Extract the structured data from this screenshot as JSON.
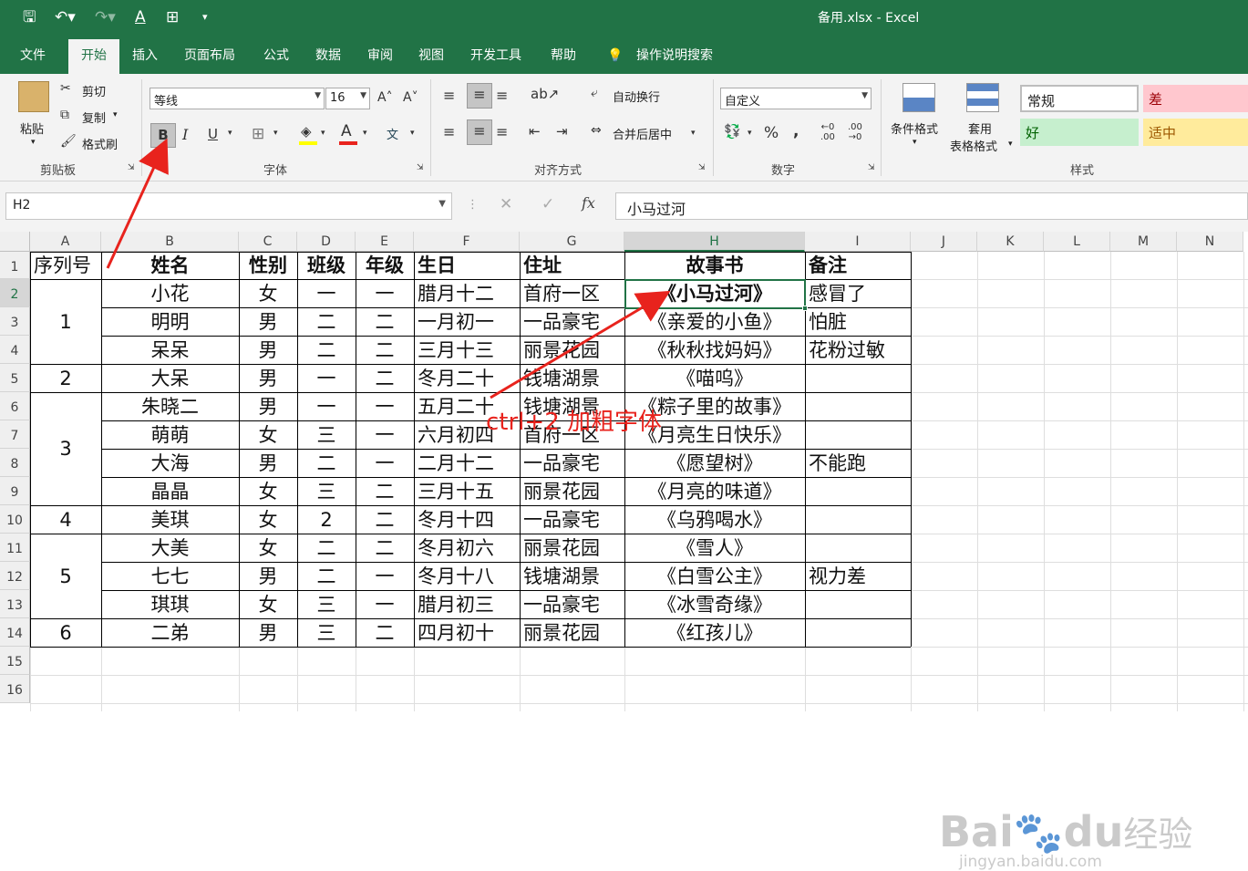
{
  "window": {
    "title": "备用.xlsx  -  Excel"
  },
  "menu": {
    "tabs": [
      "文件",
      "开始",
      "插入",
      "页面布局",
      "公式",
      "数据",
      "审阅",
      "视图",
      "开发工具",
      "帮助"
    ],
    "active_tab": "开始",
    "tell_me": "操作说明搜索"
  },
  "ribbon": {
    "clipboard": {
      "paste": "粘贴",
      "cut": "剪切",
      "copy": "复制",
      "format_painter": "格式刷",
      "label": "剪贴板"
    },
    "font": {
      "name": "等线",
      "size": "16",
      "bold": "B",
      "italic": "I",
      "underline": "U",
      "label": "字体",
      "font_color": "#e8231d",
      "fill_color": "#ffff00"
    },
    "alignment": {
      "wrap": "自动换行",
      "merge": "合并后居中",
      "label": "对齐方式"
    },
    "number": {
      "format": "自定义",
      "label": "数字"
    },
    "styles": {
      "conditional": "条件格式",
      "table_1": "套用",
      "table_2": "表格格式",
      "label": "样式",
      "normal": "常规",
      "bad": "差",
      "good": "好",
      "neutral": "适中"
    }
  },
  "formula_bar": {
    "name_box": "H2",
    "formula": "小马过河"
  },
  "sheet": {
    "columns": [
      "A",
      "B",
      "C",
      "D",
      "E",
      "F",
      "G",
      "H",
      "I",
      "J",
      "K",
      "L",
      "M",
      "N"
    ],
    "rows": [
      "1",
      "2",
      "3",
      "4",
      "5",
      "6",
      "7",
      "8",
      "9",
      "10",
      "11",
      "12",
      "13",
      "14",
      "15",
      "16"
    ],
    "header": [
      "序列号",
      "姓名",
      "性别",
      "班级",
      "年级",
      "生日",
      "住址",
      "故事书",
      "备注"
    ],
    "groups": [
      "1",
      "2",
      "3",
      "4",
      "5",
      "6"
    ],
    "data": [
      [
        "小花",
        "女",
        "一",
        "一",
        "腊月十二",
        "首府一区",
        "《小马过河》",
        "感冒了"
      ],
      [
        "明明",
        "男",
        "二",
        "二",
        "一月初一",
        "一品豪宅",
        "《亲爱的小鱼》",
        "怕脏"
      ],
      [
        "呆呆",
        "男",
        "二",
        "二",
        "三月十三",
        "丽景花园",
        "《秋秋找妈妈》",
        "花粉过敏"
      ],
      [
        "大呆",
        "男",
        "一",
        "二",
        "冬月二十",
        "钱塘湖景",
        "《喵呜》",
        ""
      ],
      [
        "朱晓二",
        "男",
        "一",
        "一",
        "五月二十",
        "钱塘湖景",
        "《粽子里的故事》",
        ""
      ],
      [
        "萌萌",
        "女",
        "三",
        "一",
        "六月初四",
        "首府一区",
        "《月亮生日快乐》",
        ""
      ],
      [
        "大海",
        "男",
        "二",
        "一",
        "二月十二",
        "一品豪宅",
        "《愿望树》",
        "不能跑"
      ],
      [
        "晶晶",
        "女",
        "三",
        "二",
        "三月十五",
        "丽景花园",
        "《月亮的味道》",
        ""
      ],
      [
        "美琪",
        "女",
        "2",
        "二",
        "冬月十四",
        "一品豪宅",
        "《乌鸦喝水》",
        ""
      ],
      [
        "大美",
        "女",
        "二",
        "二",
        "冬月初六",
        "丽景花园",
        "《雪人》",
        ""
      ],
      [
        "七七",
        "男",
        "二",
        "一",
        "冬月十八",
        "钱塘湖景",
        "《白雪公主》",
        "视力差"
      ],
      [
        "琪琪",
        "女",
        "三",
        "一",
        "腊月初三",
        "一品豪宅",
        "《冰雪奇缘》",
        ""
      ],
      [
        "二弟",
        "男",
        "三",
        "二",
        "四月初十",
        "丽景花园",
        "《红孩儿》",
        ""
      ]
    ]
  },
  "annotation": {
    "text": "ctrl+2 加粗字体",
    "color": "#e8231d"
  },
  "watermark": {
    "brand": "Bai",
    "brand2": "du",
    "cn": "经验",
    "url": "jingyan.baidu.com"
  }
}
